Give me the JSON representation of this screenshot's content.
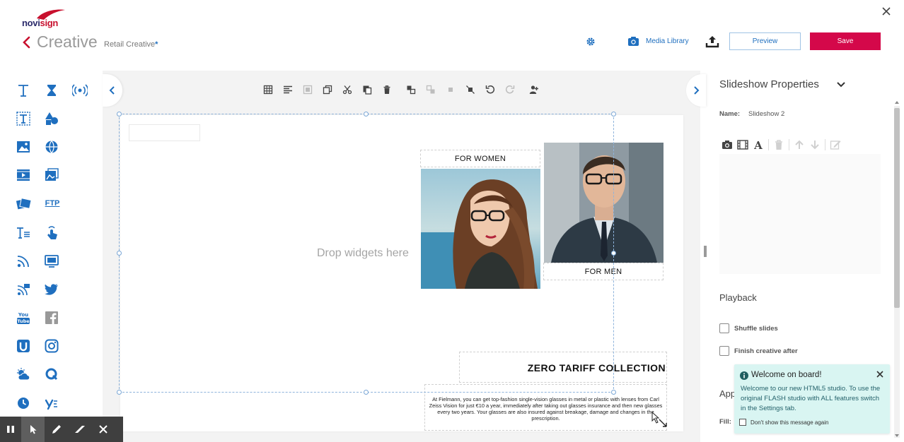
{
  "header": {
    "logo_text_a": "novi",
    "logo_text_b": "sign",
    "title": "Creative",
    "subtitle": "Retail Creative",
    "subtitle_marker": "*",
    "media_library_label": "Media Library",
    "preview_label": "Preview",
    "save_label": "Save"
  },
  "canvas": {
    "drop_label": "Drop widgets here",
    "for_women_label": "FOR WOMEN",
    "for_men_label": "FOR MEN",
    "collection_title": "ZERO TARIFF COLLECTION",
    "body_text": "At Fielmann, you can get top-fashion single-vision glasses in metal or plastic with lenses from Carl Zeiss Vision for just €10 a year, immediately after taking out glasses insurance and then new glasses every two years. Your glasses are also insured against breakage, damage and changes in the prescription."
  },
  "palette": {
    "ftp_label": "FTP"
  },
  "properties": {
    "title": "Slideshow Properties",
    "name_label": "Name:",
    "name_value": "Slideshow 2",
    "playback_title": "Playback",
    "shuffle_label": "Shuffle slides",
    "finish_label": "Finish creative after",
    "appearance_partial": "App",
    "fill_label": "Fill:"
  },
  "toast": {
    "title": "Welcome on board!",
    "body": "Welcome to our new HTML5 studio. To use the original FLASH studio with ALL features switch in the Settings tab.",
    "dont_show_label": "Don't show this message again"
  },
  "colors": {
    "brand_red": "#d4084a",
    "accent_blue": "#1f6fbf",
    "toast_bg": "#d9f5f2"
  }
}
